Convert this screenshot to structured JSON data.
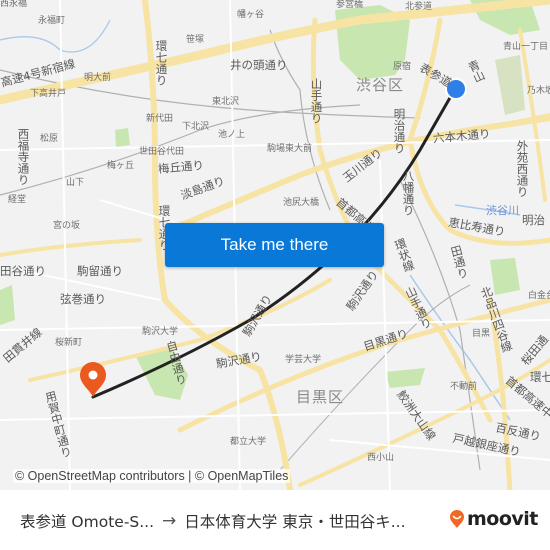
{
  "map": {
    "ward_labels": [
      "渋谷区",
      "目黒区"
    ],
    "road_labels": {
      "shuto4": "高速4号新宿線",
      "kan7": "環七通り",
      "kan7b": "環七通り",
      "inokashira": "井の頭通り",
      "yamate1": "山手通り",
      "meiji1": "明治通り",
      "omotesando": "表参道",
      "aoyama": "青山",
      "roppongi": "六本木通り",
      "gaien": "外苑西通り",
      "tamagawa": "玉川通り",
      "shuto3": "首都高速",
      "hachiman": "八幡通り",
      "ebisu": "恵比寿通り",
      "meiji2": "明治",
      "nishi": "西福寺通り",
      "umegaoka": "梅丘通り",
      "awashima": "淡島通り",
      "setagaya": "田谷通り",
      "komadome": "駒留通り",
      "tsurumaki": "弦巻通り",
      "komazawa1": "駒沢通り",
      "komazawa2": "駒沢通り",
      "jiyu": "自由通り",
      "meguro": "目黒通り",
      "yamate2": "山手通り",
      "kitashina": "北品川四谷線",
      "komaba": "田通り",
      "yoga": "用賀中町通り",
      "setagayasen": "田貫井線",
      "kamashio": "鮫洲大山線",
      "togoshi": "戸越銀座通り",
      "hyakutan": "百反通り",
      "shutoC": "首都高速中",
      "kan7c": "環七",
      "sakura": "桜田通",
      "jouko": "環状線",
      "komazawa3": "駒沢通り"
    },
    "place_labels": {
      "eifukucho": "永福町",
      "eifuku": "西永福",
      "hatagaya": "幡ヶ谷",
      "sasazuka": "笹塚",
      "meidaimae": "明大前",
      "shimotakaido": "下高井戸",
      "higashikitazawa": "東北沢",
      "shindaita": "新代田",
      "shimokitazawa": "下北沢",
      "ikenoue": "池ノ上",
      "komabatodaimae": "駒場東大前",
      "matsubara": "松原",
      "setagayadaita": "世田谷代田",
      "umegaoka": "梅ヶ丘",
      "yamashita": "山下",
      "kyodo": "経堂",
      "miyanosaka": "宮の坂",
      "ikejiriohashi": "池尻大橋",
      "sangubashi": "参宮橋",
      "kitasando": "北参道",
      "harajuku": "原宿",
      "aoyama1": "青山一丁目",
      "nogizaka": "乃木坂",
      "shibuyagawa": "渋谷川",
      "shirokanedai": "白金台",
      "meguro_st": "目黒",
      "komazawadaigaku": "駒沢大学",
      "sakurashinmachi": "桜新町",
      "gakugeidaigaku": "学芸大学",
      "fudomae": "不動前",
      "toritsudaigaku": "都立大学",
      "nishikoyama": "西小山"
    },
    "origin_marker": {
      "label": "origin",
      "color": "#2f7fe8"
    },
    "destination_marker": {
      "label": "destination",
      "color": "#ea5a1f"
    },
    "route_color": "#222222",
    "attribution": "© OpenStreetMap contributors | © OpenMapTiles"
  },
  "cta": {
    "label": "Take me there",
    "color": "#0a78d7"
  },
  "footer": {
    "origin": "表参道 Omote-S...",
    "arrow": "→",
    "destination": "日本体育大学 東京・世田谷キ...",
    "brand": "moovit",
    "brand_color": "#f26722"
  }
}
